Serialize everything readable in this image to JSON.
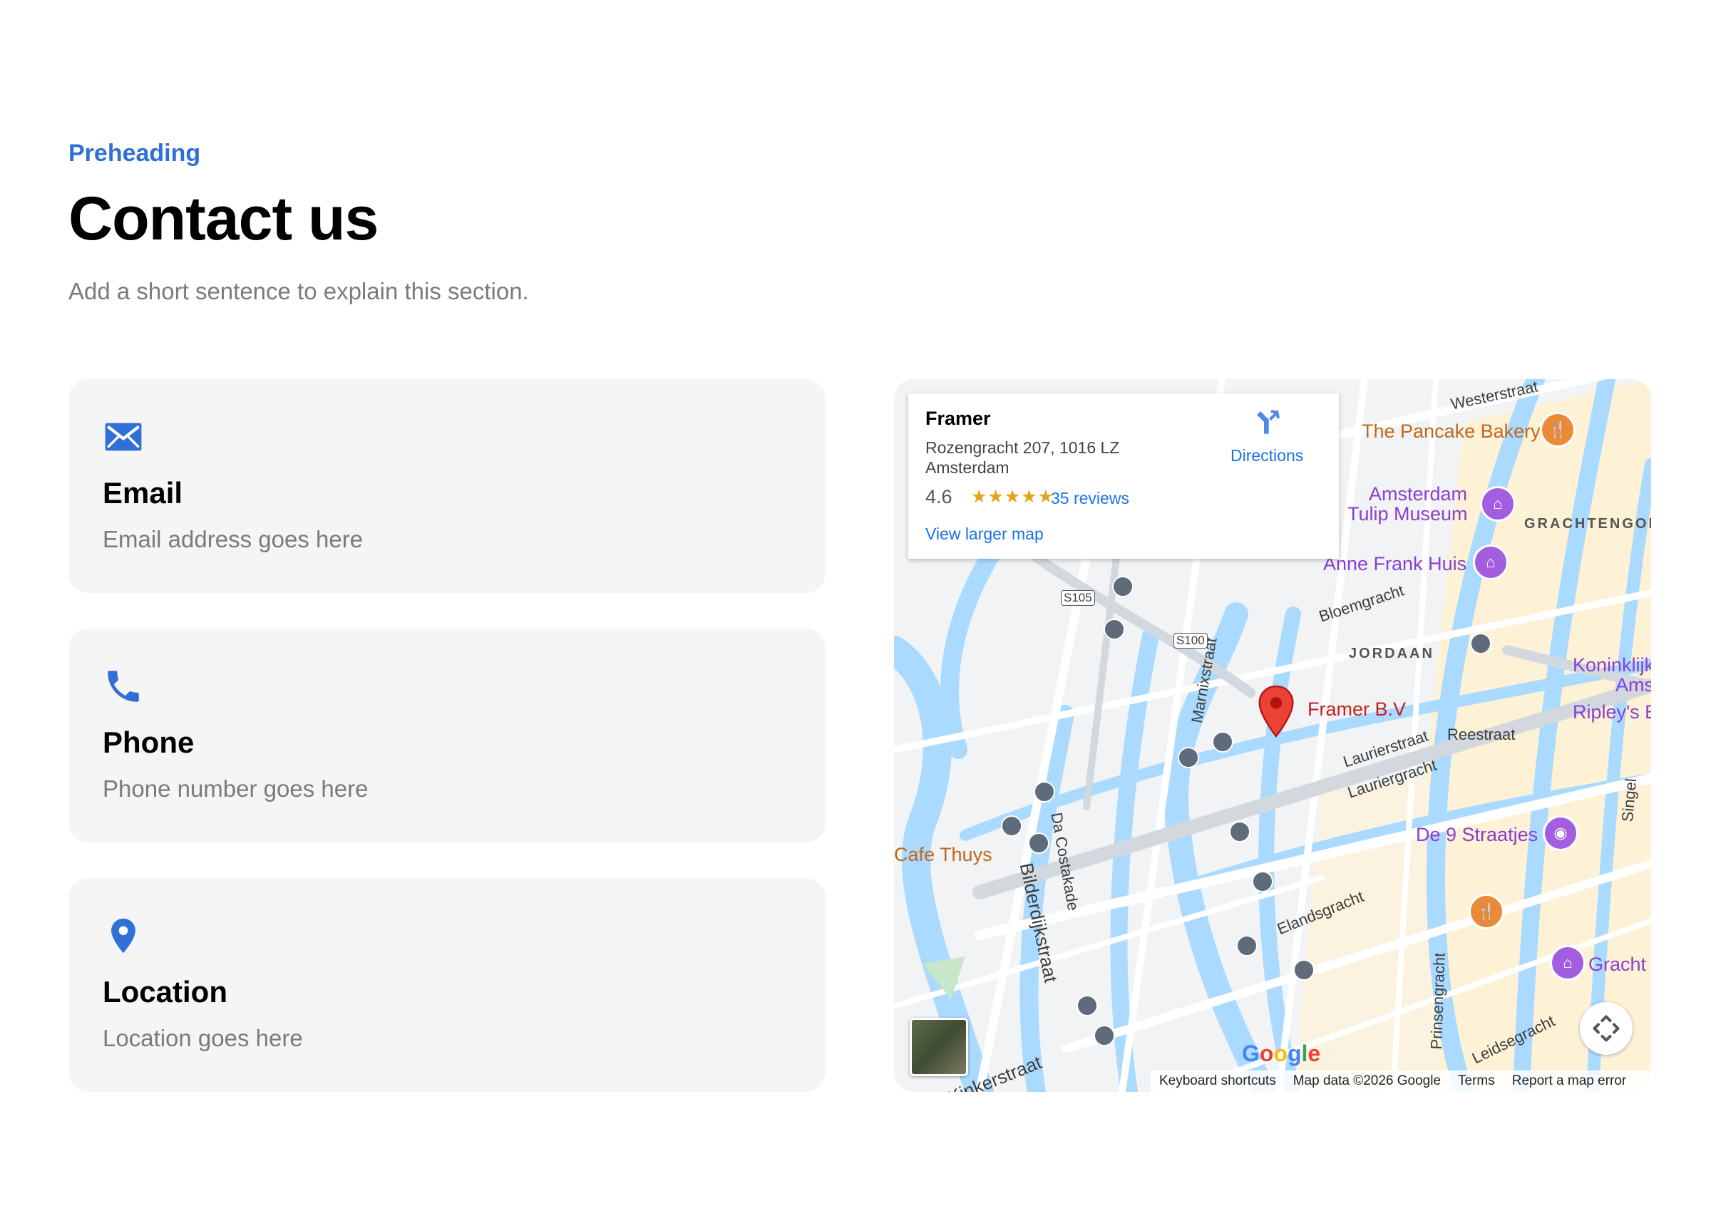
{
  "header": {
    "preheading": "Preheading",
    "title": "Contact us",
    "subtitle": "Add a short sentence to explain this section."
  },
  "cards": [
    {
      "icon": "envelope-icon",
      "title": "Email",
      "text": "Email address goes here"
    },
    {
      "icon": "phone-icon",
      "title": "Phone",
      "text": "Phone number goes here"
    },
    {
      "icon": "location-pin-icon",
      "title": "Location",
      "text": "Location goes here"
    }
  ],
  "map": {
    "info": {
      "place": "Framer",
      "address": "Rozengracht 207, 1016 LZ Amsterdam",
      "rating": "4.6",
      "stars": "★★★★★",
      "reviews": "35 reviews",
      "larger_map": "View larger map",
      "directions": "Directions"
    },
    "marker_label": "Framer B.V",
    "labels": {
      "westerstraat": "Westerstraat",
      "pancake": "The Pancake Bakery",
      "tulip1": "Amsterdam",
      "tulip2": "Tulip Museum",
      "grachtengord": "GRACHTENGORD",
      "annefrank": "Anne Frank Huis",
      "bloemgracht": "Bloemgracht",
      "jordaan": "JORDAAN",
      "marnixstraat": "Marnixstraat",
      "koninklijk": "Koninklijk",
      "ams": "Ams",
      "ripley": "Ripley's E",
      "reestraat": "Reestraat",
      "lauriergracht": "Lauriergracht",
      "laurierstraat": "Laurierstraat",
      "de9straatjes": "De 9 Straatjes",
      "cafethuys": "Cafe Thuys",
      "dacostakade": "Da Costakade",
      "bilderdijkstraat": "Bilderdijkstraat",
      "elandsgracht": "Elandsgracht",
      "prinsengracht": "Prinsengracht",
      "gracht": "Gracht",
      "kinkerstraat": "Kinkerstraat",
      "leidsegracht": "Leidsegracht",
      "s105": "S105",
      "s100": "S100",
      "singel": "Singel"
    },
    "attribution": {
      "shortcuts": "Keyboard shortcuts",
      "mapdata": "Map data ©2026 Google",
      "terms": "Terms",
      "report": "Report a map error"
    },
    "colors": {
      "water": "#aadaff",
      "road": "#ffffff",
      "land": "#f1f3f4",
      "area": "#fdf1d6",
      "accent": "#2f6fd6"
    }
  }
}
